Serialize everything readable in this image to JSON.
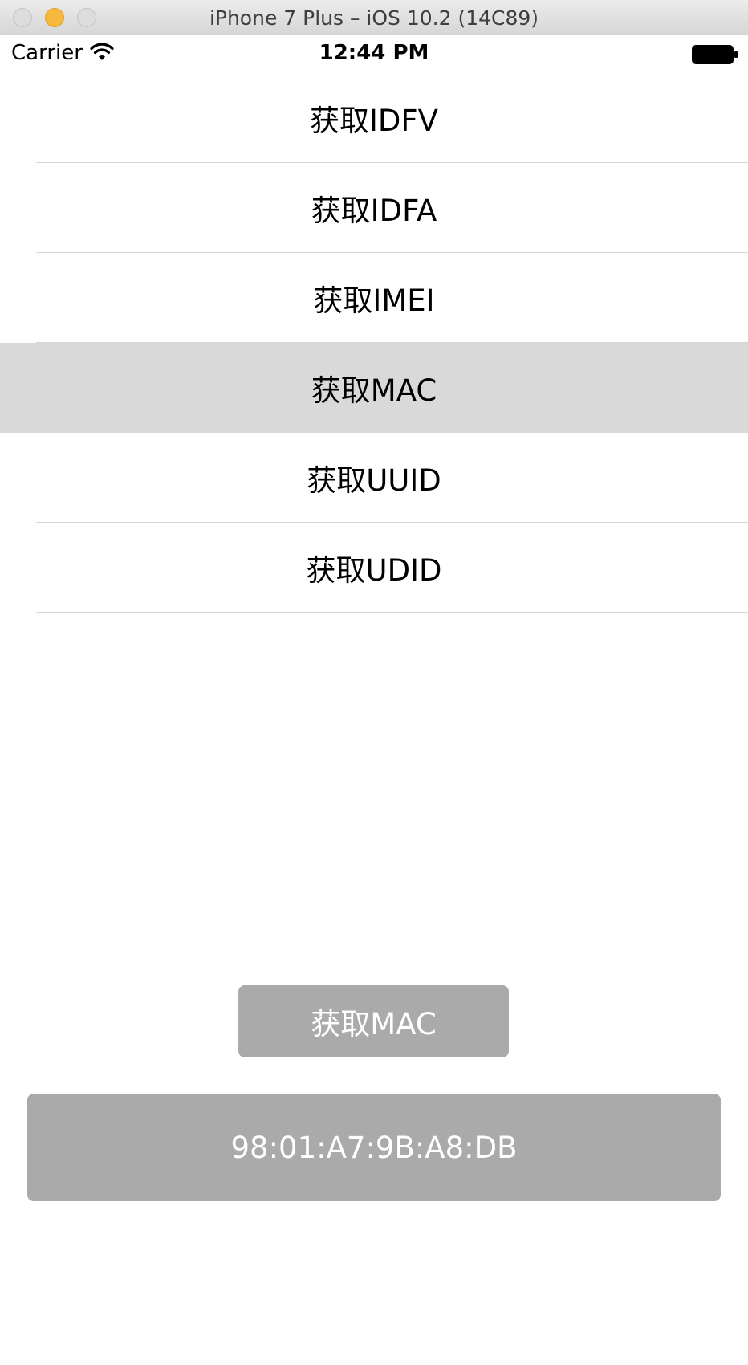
{
  "window": {
    "title": "iPhone 7 Plus – iOS 10.2 (14C89)"
  },
  "status_bar": {
    "carrier": "Carrier",
    "time": "12:44 PM"
  },
  "table": {
    "items": [
      {
        "label": "获取IDFV",
        "selected": false
      },
      {
        "label": "获取IDFA",
        "selected": false
      },
      {
        "label": "获取IMEI",
        "selected": false
      },
      {
        "label": "获取MAC",
        "selected": true
      },
      {
        "label": "获取UUID",
        "selected": false
      },
      {
        "label": "获取UDID",
        "selected": false
      }
    ]
  },
  "action": {
    "button_label": "获取MAC",
    "result": "98:01:A7:9B:A8:DB"
  },
  "colors": {
    "selected_row": "#d9d9d9",
    "button_bg": "#aaaaaa",
    "button_text": "#ffffff",
    "minimize_light": "#f6b93b"
  }
}
